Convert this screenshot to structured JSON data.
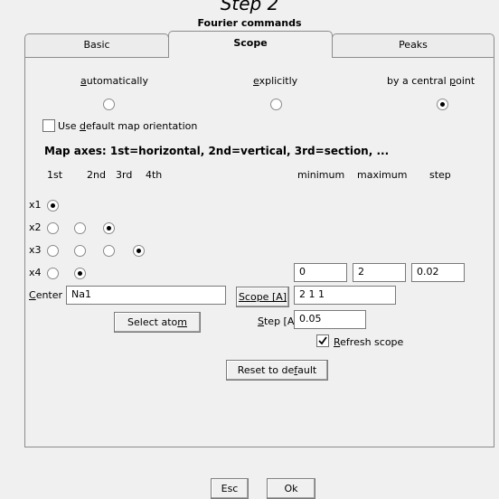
{
  "caption": "Step 2",
  "dialog": {
    "title": "Fourier commands",
    "tabs": [
      {
        "label": "Basic",
        "active": false
      },
      {
        "label": "Scope",
        "active": true
      },
      {
        "label": "Peaks",
        "active": false
      }
    ]
  },
  "mode": {
    "options": [
      {
        "pre": "",
        "key": "a",
        "post": "utomatically",
        "selected": false
      },
      {
        "pre": "",
        "key": "e",
        "post": "xplicitly",
        "selected": false
      },
      {
        "pre": "by a central ",
        "key": "p",
        "post": "oint",
        "selected": true
      }
    ]
  },
  "orientation": {
    "pre": "Use ",
    "key": "d",
    "post": "efault map orientation",
    "checked": false
  },
  "map_axes": {
    "heading": "Map axes:  1st=horizontal, 2nd=vertical, 3rd=section, ...",
    "columns": [
      "1st",
      "2nd",
      "3rd",
      "4th"
    ],
    "range_headers": [
      "minimum",
      "maximum",
      "step"
    ],
    "rows": [
      {
        "label": "x1",
        "selected": 0
      },
      {
        "label": "x2",
        "selected": 2
      },
      {
        "label": "x3",
        "selected": 3
      },
      {
        "label": "x4",
        "selected": 1,
        "minimum": "0",
        "maximum": "2",
        "step": "0.02"
      }
    ]
  },
  "center": {
    "label_key": "C",
    "label_rest": "enter",
    "value": "Na1"
  },
  "select_atom": {
    "pre": "Select ato",
    "key": "m",
    "post": ""
  },
  "scope": {
    "label": "Scope [A]",
    "value": "2 1 1"
  },
  "step": {
    "key": "S",
    "rest": "tep [A]",
    "value": "0.05"
  },
  "refresh": {
    "key": "R",
    "rest": "efresh scope",
    "checked": true
  },
  "reset": {
    "pre": "Reset to de",
    "key": "f",
    "post": "ault"
  },
  "footer": {
    "esc": "Esc",
    "ok": "Ok"
  }
}
